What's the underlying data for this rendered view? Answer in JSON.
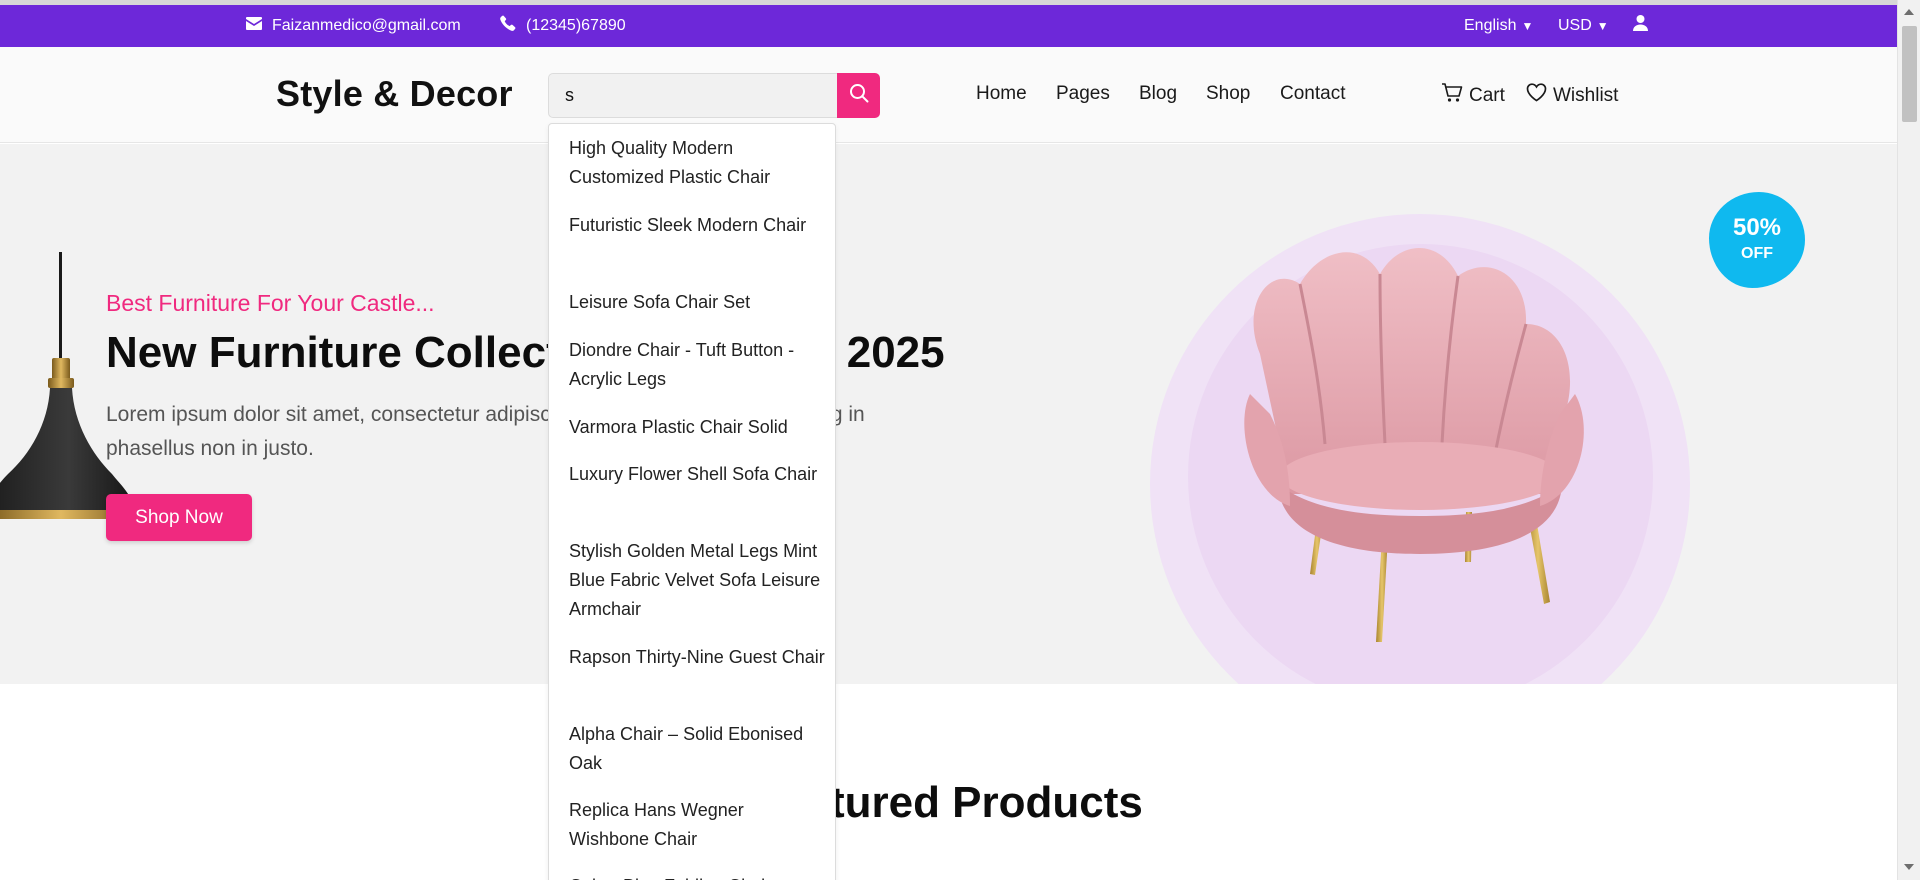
{
  "topbar": {
    "email": "Faizanmedico@gmail.com",
    "phone": "(12345)67890",
    "language": "English",
    "currency": "USD",
    "background_color": "#6d28d9",
    "email_icon": "envelope-icon",
    "phone_icon": "phone-icon",
    "user_icon": "user-icon"
  },
  "header": {
    "logo": "Style & Decor",
    "search": {
      "value": "s",
      "button_icon": "search-icon"
    },
    "nav": [
      "Home",
      "Pages",
      "Blog",
      "Shop",
      "Contact"
    ],
    "cart_label": "Cart",
    "wishlist_label": "Wishlist",
    "cart_icon": "cart-icon",
    "wishlist_icon": "heart-icon"
  },
  "hero": {
    "subtitle": "Best Furniture For Your Castle...",
    "title": "New Furniture Collection Trends in 2025",
    "text": "Lorem ipsum dolor sit amet, consectetur adipiscing elit. Magna in est adipiscing in phasellus non in justo.",
    "button": "Shop Now",
    "badge_percent": "50%",
    "badge_off": "OFF",
    "accent_color": "#f0297f",
    "badge_color": "#0fb9ef"
  },
  "featured": {
    "title": "Featured Products"
  },
  "search_suggestions": [
    "High Quality Modern Customized Plastic Chair",
    "Futuristic Sleek Modern Chair",
    "Leisure Sofa Chair Set",
    "Diondre Chair - Tuft Button - Acrylic Legs",
    "Varmora Plastic Chair Solid",
    "Luxury Flower Shell Sofa Chair",
    "Stylish Golden Metal Legs Mint Blue Fabric Velvet Sofa Leisure Armchair",
    "Rapson Thirty-Nine Guest Chair",
    "Alpha Chair – Solid Ebonised Oak",
    "Replica Hans Wegner Wishbone Chair",
    "Cobra Blue Folding Chair"
  ]
}
